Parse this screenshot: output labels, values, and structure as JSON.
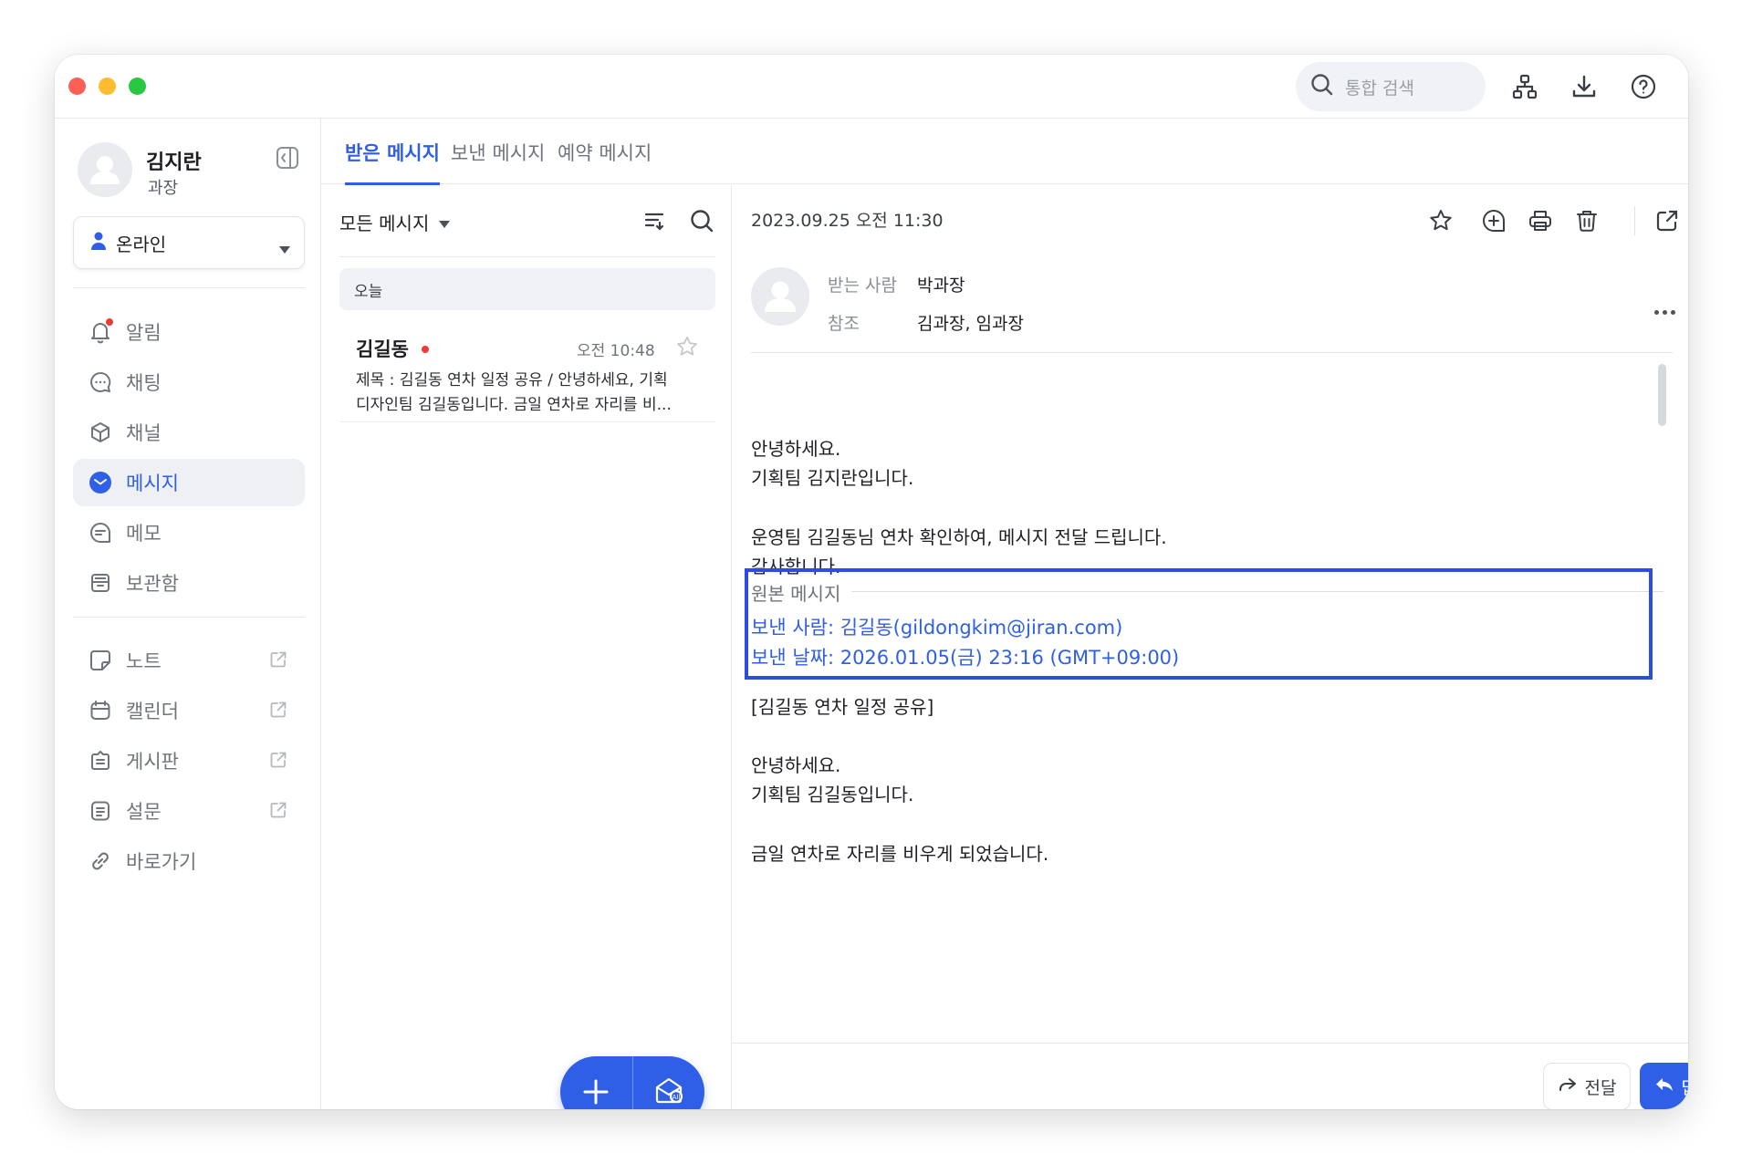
{
  "topbar": {
    "search_placeholder": "통합 검색"
  },
  "profile": {
    "name": "김지란",
    "title": "과장",
    "status": "온라인"
  },
  "sidebar": {
    "items": [
      {
        "label": "알림",
        "icon": "bell-icon",
        "badge": true
      },
      {
        "label": "채팅",
        "icon": "chat-bubble-icon"
      },
      {
        "label": "채널",
        "icon": "cube-icon"
      },
      {
        "label": "메시지",
        "icon": "envelope-icon",
        "active": true
      },
      {
        "label": "메모",
        "icon": "memo-icon"
      },
      {
        "label": "보관함",
        "icon": "archive-icon"
      }
    ],
    "external_items": [
      {
        "label": "노트",
        "icon": "note-icon",
        "external": true
      },
      {
        "label": "캘린더",
        "icon": "calendar-icon",
        "external": true
      },
      {
        "label": "게시판",
        "icon": "board-icon",
        "external": true
      },
      {
        "label": "설문",
        "icon": "survey-icon",
        "external": true
      },
      {
        "label": "바로가기",
        "icon": "link-icon",
        "external": false
      }
    ]
  },
  "tabs": [
    {
      "label": "받은 메시지",
      "active": true
    },
    {
      "label": "보낸 메시지"
    },
    {
      "label": "예약 메시지"
    }
  ],
  "list": {
    "filter": "모든 메시지",
    "group": "오늘",
    "messages": [
      {
        "sender": "김길동",
        "unread": true,
        "time": "오전 10:48",
        "preview_line1": "제목 : 김길동 연차 일정 공유 / 안녕하세요, 기획",
        "preview_line2": "디자인팀 김길동입니다. 금일 연차로 자리를 비..."
      }
    ]
  },
  "reader": {
    "date": "2023.09.25 오전 11:30",
    "to_label": "받는 사람",
    "to": "박과장",
    "cc_label": "참조",
    "cc": "김과장, 임과장",
    "body": {
      "line1": "안녕하세요.",
      "line2": "기획팀 김지란입니다.",
      "line3": "운영팀 김길동님 연차 확인하여, 메시지 전달 드립니다.",
      "line4": "감사합니다."
    },
    "original": {
      "label": "원본 메시지",
      "from": "보낸 사람: 김길동(gildongkim@jiran.com)",
      "date": "보낸 날짜: 2026.01.05(금) 23:16 (GMT+09:00)",
      "subject": "[김길동 연차 일정 공유]",
      "line1": "안녕하세요.",
      "line2": "기획팀 김길동입니다.",
      "line3": "금일 연차로 자리를 비우게 되었습니다."
    },
    "forward_label": "전달",
    "reply_label": "답장"
  },
  "colors": {
    "accent": "#2f5fe6",
    "highlight_border": "#2b4de6",
    "unread_dot": "#ef3b36"
  }
}
